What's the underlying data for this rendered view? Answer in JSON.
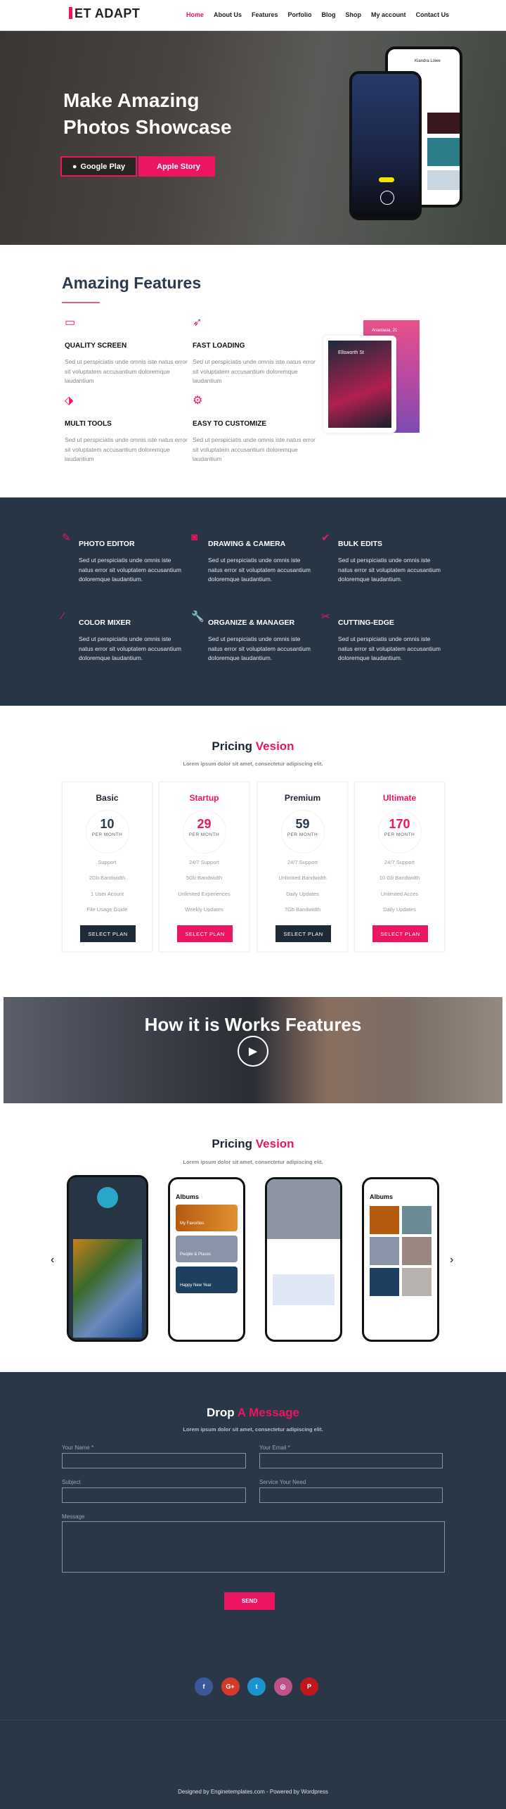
{
  "brand": {
    "logo": "ET ADAPT",
    "accent": "#ec1561",
    "dark": "#283545"
  },
  "nav": {
    "items": [
      "Home",
      "About Us",
      "Features",
      "Porfolio",
      "Blog",
      "Shop",
      "My account",
      "Contact Us"
    ],
    "active": "Home"
  },
  "hero": {
    "title_line1": "Make Amazing",
    "title_line2": "Photos Showcase",
    "google_play": "Google Play",
    "apple_store": "Apple Story",
    "phone_profile_name": "Kiandra Lowe"
  },
  "features": {
    "title": "Amazing Features",
    "items": [
      {
        "icon": "monitor-icon",
        "title": "QUALITY SCREEN",
        "text": "Sed ut perspiciatis unde omnis iste natus error sit voluptatem accusantium doloremque laudantium"
      },
      {
        "icon": "rocket-icon",
        "title": "FAST LOADING",
        "text": "Sed ut perspiciatis unde omnis iste natus error sit voluptatem accusantium doloremque laudantium"
      },
      {
        "icon": "tags-icon",
        "title": "MULTI TOOLS",
        "text": "Sed ut perspiciatis unde omnis iste natus error sit voluptatem accusantium doloremque laudantium"
      },
      {
        "icon": "gears-icon",
        "title": "EASY TO CUSTOMIZE",
        "text": "Sed ut perspiciatis unde omnis iste natus error sit voluptatem accusantium doloremque laudantium"
      }
    ],
    "image_texts": [
      "Ellsworth St",
      "Anastasia, 21"
    ]
  },
  "services": [
    {
      "icon": "edit-icon",
      "title": "PHOTO EDITOR",
      "text": "Sed ut perspiciatis unde omnis iste natus error sit voluptatem accusantium doloremque laudantium."
    },
    {
      "icon": "camera-icon",
      "title": "DRAWING & CAMERA",
      "text": "Sed ut perspiciatis unde omnis iste natus error sit voluptatem accusantium doloremque laudantium."
    },
    {
      "icon": "check-icon",
      "title": "BULK EDITS",
      "text": "Sed ut perspiciatis unde omnis iste natus error sit voluptatem accusantium doloremque laudantium."
    },
    {
      "icon": "magic-wand-icon",
      "title": "COLOR MIXER",
      "text": "Sed ut perspiciatis unde omnis iste natus error sit voluptatem accusantium doloremque laudantium."
    },
    {
      "icon": "wrench-icon",
      "title": "ORGANIZE & MANAGER",
      "text": "Sed ut perspiciatis unde omnis iste natus error sit voluptatem accusantium doloremque laudantium."
    },
    {
      "icon": "scissors-icon",
      "title": "CUTTING-EDGE",
      "text": "Sed ut perspiciatis unde omnis iste natus error sit voluptatem accusantium doloremque laudantium."
    }
  ],
  "pricing": {
    "title_a": "Pricing",
    "title_b": "Vesion",
    "subtitle": "Lorem ipsum dolor sit amet, consectetur adipiscing elit.",
    "plans": [
      {
        "name": "Basic",
        "price": "10",
        "per": "PER MONTH",
        "features": [
          "Support",
          "2Gb Bandwidth",
          "1 User Acount",
          "File Usage Guide"
        ],
        "button": "SELECT PLAN"
      },
      {
        "name": "Startup",
        "price": "29",
        "per": "PER MONTH",
        "features": [
          "24/7 Support",
          "5Gb Bandwidth",
          "Unlimited Experiences",
          "Weekly Updates"
        ],
        "button": "SELECT PLAN"
      },
      {
        "name": "Premium",
        "price": "59",
        "per": "PER MONTH",
        "features": [
          "24/7 Support",
          "Unlimited Bandwidth",
          "Daily Updates",
          "7Gb Bandwidth"
        ],
        "button": "SELECT PLAN"
      },
      {
        "name": "Ultimate",
        "price": "170",
        "per": "PER MONTH",
        "features": [
          "24/7 Support",
          "10 Gb Bandwidth",
          "Unlimited Acces",
          "Daily Updates"
        ],
        "button": "SELECT PLAN"
      }
    ]
  },
  "video": {
    "title": "How it is Works Features"
  },
  "screens": {
    "title_a": "Pricing",
    "title_b": "Vesion",
    "subtitle": "Lorem ipsum dolor sit amet, consectetur adipiscing elit.",
    "album_title": "Albums",
    "tiles": [
      "My Favorites",
      "People & Places",
      "Happy New Year"
    ]
  },
  "contact": {
    "title_a": "Drop",
    "title_b": "A Message",
    "subtitle": "Lorem ipsum dolor sit amet, consectetur adipiscing elit.",
    "name_label": "Your Name *",
    "email_label": "Your Email *",
    "subject_label": "Subject",
    "service_label": "Service Your Need",
    "message_label": "Message",
    "send": "SEND"
  },
  "social": [
    {
      "icon": "facebook-icon",
      "glyph": "f",
      "color": "#3b5998"
    },
    {
      "icon": "google-plus-icon",
      "glyph": "G+",
      "color": "#d33a2c"
    },
    {
      "icon": "twitter-icon",
      "glyph": "t",
      "color": "#1a95d0"
    },
    {
      "icon": "instagram-icon",
      "glyph": "◎",
      "color": "#c0528a"
    },
    {
      "icon": "pinterest-icon",
      "glyph": "P",
      "color": "#c0161d"
    }
  ],
  "footer": {
    "text": "Designed by Enginetemplates.com - Powered by Wordpress"
  }
}
